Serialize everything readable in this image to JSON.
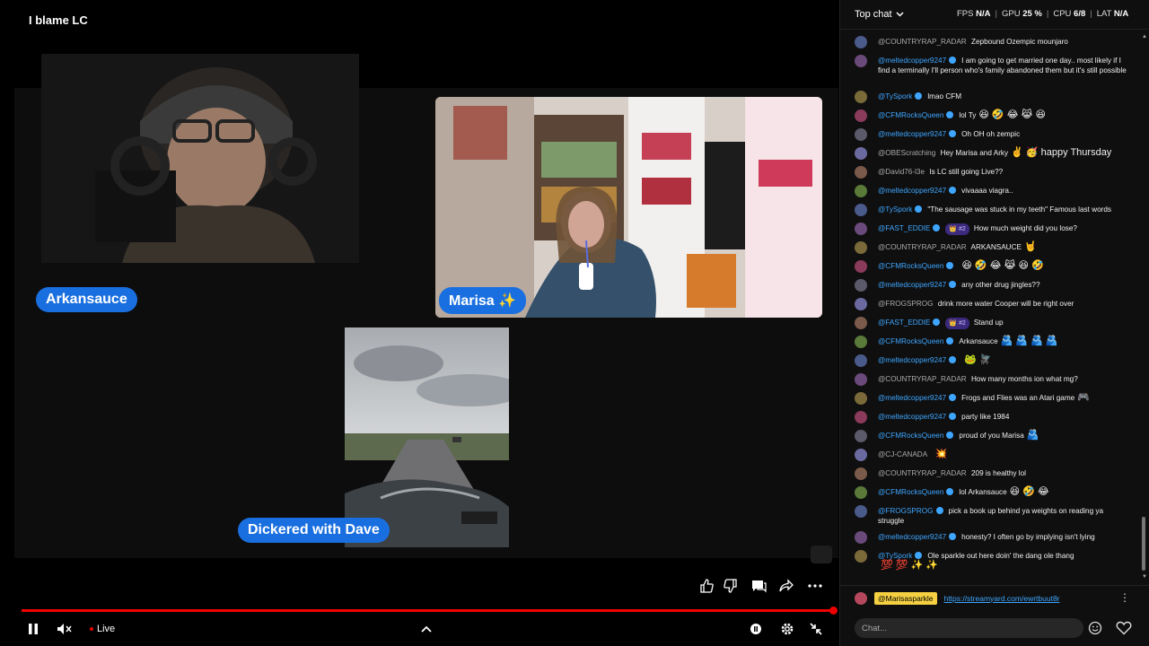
{
  "stream": {
    "title": "I blame LC",
    "participants": [
      {
        "name": "Arkansauce"
      },
      {
        "name": "Marisa ✨"
      },
      {
        "name": "Dickered with Dave"
      }
    ]
  },
  "player": {
    "live_label": "Live",
    "progress": 1.0,
    "icons": [
      "like-icon",
      "dislike-icon",
      "chat-icon",
      "share-icon",
      "more-icon",
      "pause-icon",
      "mute-icon",
      "chevron-up-icon",
      "autoplay-icon",
      "settings-icon",
      "fullscreen-exit-icon"
    ]
  },
  "chat": {
    "mode_label": "Top chat",
    "stats": {
      "fps_label": "FPS",
      "fps_value": "N/A",
      "gpu_label": "GPU",
      "gpu_value": "25 %",
      "cpu_label": "CPU",
      "cpu_value": "6/8",
      "lat_label": "LAT",
      "lat_value": "N/A"
    },
    "messages": [
      {
        "author": "@COUNTRYRAP_RADAR",
        "verified": false,
        "text": "Zepbound Ozempic mounjaro",
        "emojis": ""
      },
      {
        "author": "@meltedcopper9247",
        "verified": true,
        "text": "I am going to get married one day.. most likely if I find a terminally I'll person who's family abandoned them but it's still possible",
        "emojis": ""
      },
      {
        "author": "@TySpork",
        "verified": true,
        "text": "lmao CFM",
        "emojis": ""
      },
      {
        "author": "@CFMRocksQueen",
        "verified": true,
        "text": "lol Ty",
        "emojis": "😆 🤣 😂 😹 😆"
      },
      {
        "author": "@meltedcopper9247",
        "verified": true,
        "text": "Oh OH oh zempic",
        "emojis": ""
      },
      {
        "author": "@OBEScratching",
        "verified": false,
        "text": "Hey Marisa and Arky",
        "emojis": "✌️ 🥳 happy Thursday"
      },
      {
        "author": "@David76-l3e",
        "verified": false,
        "text": "Is LC still going Live??",
        "emojis": ""
      },
      {
        "author": "@meltedcopper9247",
        "verified": true,
        "text": "vivaaaa viagra..",
        "emojis": ""
      },
      {
        "author": "@TySpork",
        "verified": true,
        "text": "\"The sausage was stuck in my teeth\" Famous last words",
        "emojis": ""
      },
      {
        "author": "@FAST_EDDIE",
        "verified": true,
        "badge": "👑 #2",
        "text": "How much weight did you lose?",
        "emojis": ""
      },
      {
        "author": "@COUNTRYRAP_RADAR",
        "verified": false,
        "text": "ARKANSAUCE",
        "emojis": "🤘"
      },
      {
        "author": "@CFMRocksQueen",
        "verified": true,
        "text": "",
        "emojis": "😆 🤣 😂 😹 😆 🤣"
      },
      {
        "author": "@meltedcopper9247",
        "verified": true,
        "text": "any other drug jingles??",
        "emojis": ""
      },
      {
        "author": "@FROGSPROG",
        "verified": false,
        "text": "drink more water Cooper will be right over",
        "emojis": ""
      },
      {
        "author": "@FAST_EDDIE",
        "verified": true,
        "badge": "👑 #2",
        "text": "Stand up",
        "emojis": ""
      },
      {
        "author": "@CFMRocksQueen",
        "verified": true,
        "text": "Arkansauce",
        "emojis": "🫂 🫂 🫂 🫂"
      },
      {
        "author": "@meltedcopper9247",
        "verified": true,
        "text": "",
        "emojis": "🐸 🪰"
      },
      {
        "author": "@COUNTRYRAP_RADAR",
        "verified": false,
        "text": "How many months ion what mg?",
        "emojis": ""
      },
      {
        "author": "@meltedcopper9247",
        "verified": true,
        "text": "Frogs and Flies was an Atari game",
        "emojis": "🎮"
      },
      {
        "author": "@meltedcopper9247",
        "verified": true,
        "text": "party like 1984",
        "emojis": ""
      },
      {
        "author": "@CFMRocksQueen",
        "verified": true,
        "text": "proud of you Marisa",
        "emojis": "🫂"
      },
      {
        "author": "@CJ-CANADA",
        "verified": false,
        "text": "",
        "emojis": "💥"
      },
      {
        "author": "@COUNTRYRAP_RADAR",
        "verified": false,
        "text": "209 is healthy lol",
        "emojis": ""
      },
      {
        "author": "@CFMRocksQueen",
        "verified": true,
        "text": "lol Arkansauce",
        "emojis": "😆 🤣 😂"
      },
      {
        "author": "@FROGSPROG",
        "verified": true,
        "text": "pick a book up behind ya weights on reading ya struggle",
        "emojis": ""
      },
      {
        "author": "@meltedcopper9247",
        "verified": true,
        "text": "honesty? I often go by implying isn't lying",
        "emojis": ""
      },
      {
        "author": "@TySpork",
        "verified": true,
        "text": "Ole sparkle out here doin' the dang ole thang",
        "emojis": "💯 💯 ✨ ✨"
      }
    ],
    "pinned": {
      "author": "@Marisasparkle",
      "link": "https://streamyard.com/ewrtbuut8r"
    },
    "input_placeholder": "Chat..."
  },
  "colors": {
    "accent": "#3ea6ff",
    "live_red": "#e00000",
    "name_tag": "#1a6fe0",
    "pinned_highlight": "#f5d142"
  }
}
